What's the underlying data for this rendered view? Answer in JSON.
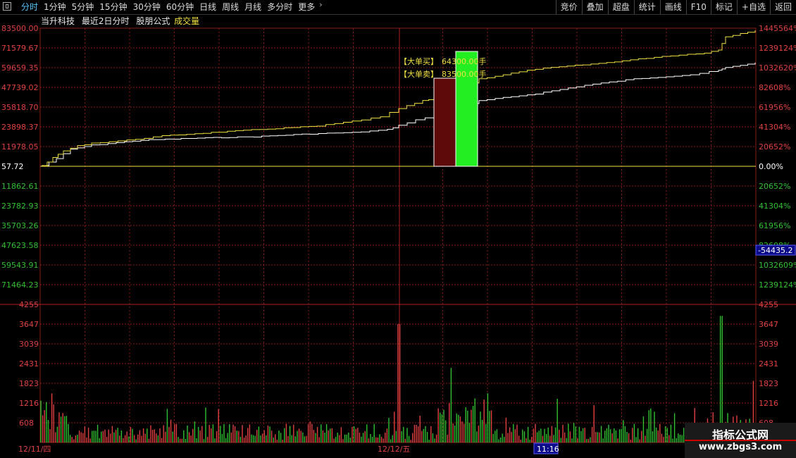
{
  "toolbar": {
    "tabs": [
      "分时",
      "1分钟",
      "5分钟",
      "15分钟",
      "30分钟",
      "60分钟",
      "日线",
      "周线",
      "月线",
      "多分时",
      "更多"
    ],
    "active_tab": 0,
    "right_buttons": [
      "竞价",
      "叠加",
      "超盘",
      "统计",
      "画线",
      "F10",
      "标记",
      "+自选",
      "返回"
    ]
  },
  "info": {
    "stock_name": "当升科技",
    "period": "最近2日分时",
    "formula": "股朋公式",
    "indicator": "成交量"
  },
  "axis": {
    "left_labels": [
      "83500.00",
      "71579.67",
      "59659.35",
      "47739.02",
      "35818.70",
      "23898.37",
      "11978.05",
      "57.72",
      "11862.61",
      "23782.93",
      "35703.26",
      "47623.58",
      "59543.91",
      "71464.23"
    ],
    "right_labels": [
      "1445564%",
      "1239124%",
      "1032620%",
      "82608%",
      "61956%",
      "41304%",
      "20652%",
      "0.00%",
      "20652%",
      "41304%",
      "61956%",
      "82608%",
      "1032609%",
      "1239124%"
    ],
    "cursor_value": "-54435.2",
    "volume_labels": [
      "4255",
      "3647",
      "3039",
      "2431",
      "1823",
      "1216",
      "608"
    ],
    "date_labels": [
      "12/11/四",
      "12/12/五"
    ],
    "time_cursor": "11:16"
  },
  "annotations": {
    "big_buy_tag": "【大单买】",
    "big_buy_value": "64300.00手",
    "big_sell_tag": "【大单卖】",
    "big_sell_value": "83500.00手"
  },
  "colors": {
    "grid": "#8c1a1a",
    "rise": "#e04040",
    "fall": "#30c030",
    "price_line": "#f0e040",
    "avg_line": "#ffffff",
    "buy_bar": "#5e0a0a",
    "sell_bar": "#22ee22",
    "left_up_text": "#e04040",
    "left_down_text": "#30c030"
  },
  "watermark": {
    "line1": "指标公式网",
    "line2": "www.zbgs3.com"
  }
}
